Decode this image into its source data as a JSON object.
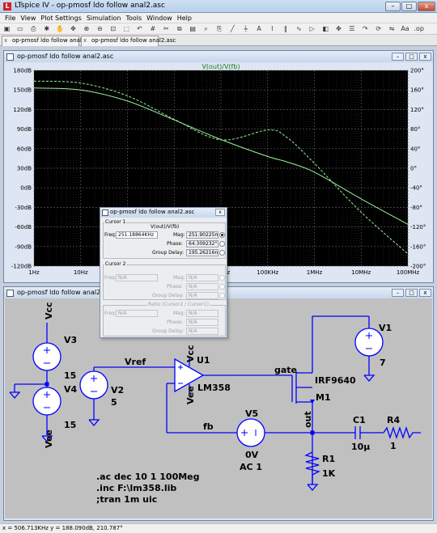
{
  "app": {
    "window_title": "LTspice IV - op-pmosf ldo follow anal2.asc",
    "minimize": "–",
    "maximize": "□",
    "close": "x"
  },
  "menu": [
    "File",
    "View",
    "Plot Settings",
    "Simulation",
    "Tools",
    "Window",
    "Help"
  ],
  "toolbar_icons": [
    "open-icon",
    "save-icon",
    "print-icon",
    "run-icon",
    "halt-icon",
    "pan-icon",
    "zoom-in-icon",
    "zoom-out-icon",
    "zoom-fit-icon",
    "zoom-area-icon",
    "undo-icon",
    "grid-icon",
    "cut-icon",
    "copy-icon",
    "paste-icon",
    "find-icon",
    "print-preview-icon",
    "wire-icon",
    "ground-icon",
    "label-icon",
    "resistor-icon",
    "capacitor-icon",
    "inductor-icon",
    "diode-icon",
    "component-icon",
    "move-icon",
    "drag-icon",
    "redo-icon",
    "rotate-icon",
    "mirror-icon",
    "text-icon",
    "spice-icon"
  ],
  "tabs": [
    {
      "label": "op-pmosf ldo follow anal2.asc",
      "close": "x"
    },
    {
      "label": "op-pmosf ldo follow anal2.asc",
      "close": "x"
    }
  ],
  "plot_window": {
    "title": "op-pmosf ldo follow anal2.asc",
    "trace_label": "V(out)/V(fb)",
    "trace_color": "#9cf09c",
    "background": "#000000",
    "grid_color": "#5a5a5a"
  },
  "chart_data": {
    "type": "line",
    "title": "V(out)/V(fb)",
    "xscale": "log",
    "xlim": [
      1,
      100000000
    ],
    "xticks": [
      "1Hz",
      "10Hz",
      "100Hz",
      "1KHz",
      "10KHz",
      "100KHz",
      "1MHz",
      "10MHz",
      "100MHz"
    ],
    "left_axis": {
      "unit": "dB",
      "ylim": [
        -120,
        180
      ],
      "ticks": [
        "180dB",
        "150dB",
        "120dB",
        "90dB",
        "60dB",
        "30dB",
        "0dB",
        "-30dB",
        "-60dB",
        "-90dB",
        "-120dB"
      ]
    },
    "right_axis": {
      "unit": "°",
      "ylim": [
        -200,
        200
      ],
      "ticks": [
        "200°",
        "160°",
        "120°",
        "80°",
        "40°",
        "0°",
        "-40°",
        "-80°",
        "-120°",
        "-160°",
        "-200°"
      ]
    },
    "grid": true,
    "series": [
      {
        "role": "magnitude",
        "style": "solid",
        "axis": "left",
        "x": [
          1,
          10,
          100,
          1000,
          10000,
          100000,
          250000,
          1000000,
          10000000,
          100000000
        ],
        "y": [
          153,
          150,
          133,
          104,
          74,
          48,
          40,
          24,
          -17,
          -56
        ]
      },
      {
        "role": "phase",
        "style": "dashed",
        "axis": "right",
        "x": [
          1,
          10,
          100,
          1000,
          10000,
          100000,
          251000,
          1000000,
          10000000,
          100000000
        ],
        "y": [
          178,
          174,
          148,
          100,
          58,
          78,
          64,
          10,
          -90,
          -175
        ]
      }
    ]
  },
  "cursor_dialog": {
    "title": "op-pmosf ldo follow anal2.asc",
    "close": "x",
    "cursor1_label": "Cursor 1",
    "trace_name": "V(out)/V(fb)",
    "freq_label": "Freq:",
    "freq_value": "251.18864KHz",
    "mag_label": "Mag:",
    "mag_value": "251.90225mdB",
    "phase_label": "Phase:",
    "phase_value": "64.309232°",
    "group_delay_label": "Group Delay:",
    "group_delay_value": "195.26216ns",
    "cursor2_label": "Cursor 2",
    "na_value": "N/A",
    "ratio_label": "Ratio (Cursor2 / Cursor1)"
  },
  "schematic": {
    "title": "op-pmosf ldo follow anal2.asc",
    "labels": {
      "vcc_top": "Vcc",
      "v3": "V3",
      "v3_val": "15",
      "v4": "V4",
      "v4_val": "15",
      "vee_left": "Vee",
      "vref": "Vref",
      "v2": "V2",
      "v2_val": "5",
      "u1": "U1",
      "vcc_u1": "Vcc",
      "vee_u1": "Vee",
      "lm358": "LM358",
      "gate": "gate",
      "irf": "IRF9640",
      "m1": "M1",
      "v1": "V1",
      "v1_val": "7",
      "fb": "fb",
      "v5": "V5",
      "v5_dc": "0V",
      "v5_ac": "AC 1",
      "out": "out",
      "c1": "C1",
      "c1_val": "10µ",
      "r4": "R4",
      "r4_val": "1",
      "r1": "R1",
      "r1_val": "1K"
    },
    "directives": [
      ".ac dec 10 1 100Meg",
      ".inc F:\\lm358.lib",
      ";tran 1m uic"
    ]
  },
  "status": "x = 506.713KHz   y = 188.090dB, 210.787°"
}
